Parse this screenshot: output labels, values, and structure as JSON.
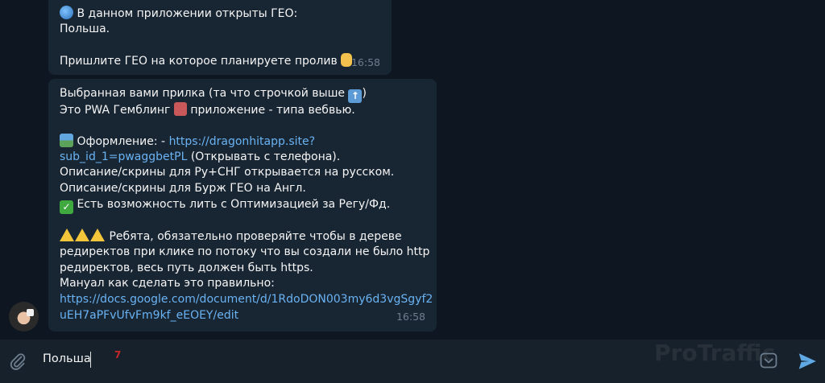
{
  "messages": [
    {
      "lines": [
        "В данном приложении открыты ГЕО:",
        "Польша.",
        "",
        "Пришлите ГЕО на которое планируете пролив"
      ],
      "time": "16:58",
      "emojis": {
        "globe": "globe-icon",
        "hand": "pointing-down-icon"
      }
    },
    {
      "line1": "Выбранная вами прилка (та что строчкой выше",
      "line1_end": ")",
      "line2_a": "Это PWA Гемблинг",
      "line2_b": "приложение - типа вебвью.",
      "line4_a": "Оформление: -",
      "link1_a": "https://dragonhitapp.site?",
      "link1_b": "sub_id_1=pwaggbetPL",
      "line5_b": "(Открывать с телефона).",
      "line6": "Описание/скрины для Ру+СНГ открывается на русском.",
      "line7": "Описание/скрины для Бурж ГЕО на Англ.",
      "line8": "Есть возможность лить с Оптимизацией за Регу/Фд.",
      "line10": "Ребята, обязательно проверяйте чтобы в дереве",
      "line11": "редиректов при клике по потоку что вы создали не было http",
      "line12": "редиректов, весь путь должен быть https.",
      "line13": "Мануал как сделать это правильно:",
      "link2_a": "https://docs.google.com/document/d/1RdoDON003my6d3vgSgyf2",
      "link2_b": "uEH7aPFvUfvFm9kf_eEOEY/edit",
      "time": "16:58"
    }
  ],
  "composer": {
    "text": "Польша",
    "red_mark": "7"
  },
  "watermark": "ProTraffic",
  "colors": {
    "background": "#0e1621",
    "bubble": "#182533",
    "link": "#6ab3f3",
    "input_bar": "#17212b",
    "send": "#5fa8e4"
  }
}
